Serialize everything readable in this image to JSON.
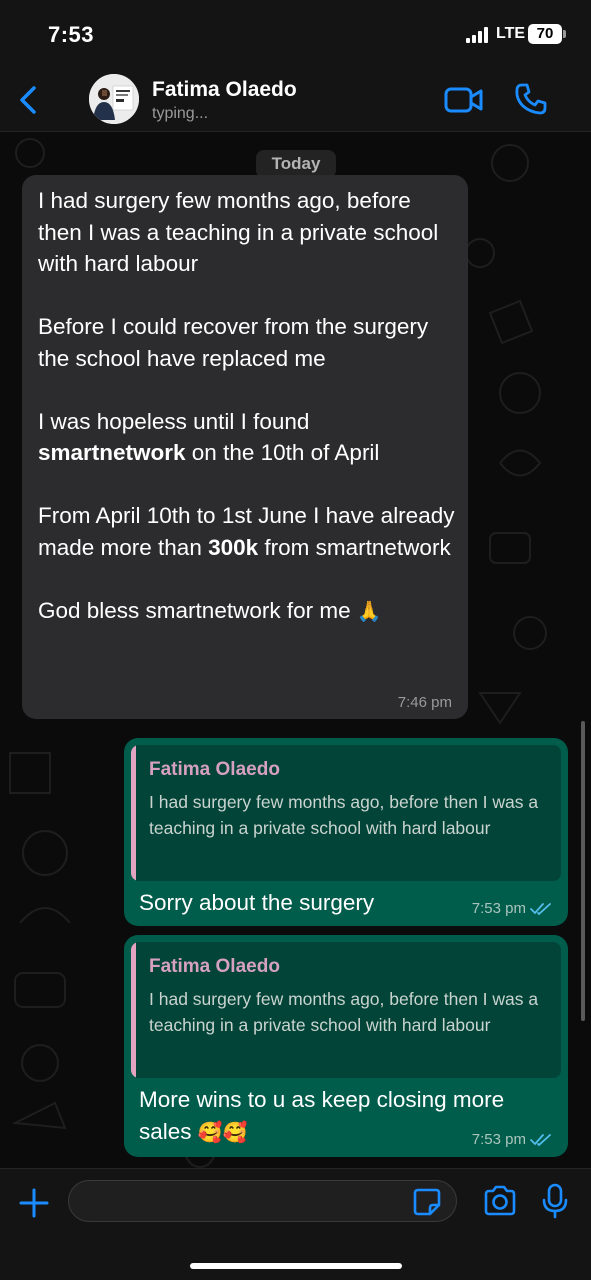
{
  "status_bar": {
    "time": "7:53",
    "network": "LTE",
    "battery": "70"
  },
  "header": {
    "contact_name": "Fatima Olaedo",
    "contact_status": "typing...",
    "icons": [
      "back-chevron-icon",
      "video-camera-icon",
      "phone-icon"
    ],
    "accent_color": "#1a8cff"
  },
  "chat": {
    "date_label": "Today",
    "incoming": {
      "p1": "I had surgery few months ago, before then I was a teaching in a private school with hard labour",
      "p2": "Before I could recover from the surgery the school have replaced me",
      "p3_before": "I was hopeless until I found ",
      "p3_bold": "smartnetwork",
      "p3_after": " on the 10th of April",
      "p4_before": "From April 10th to 1st June I have already made more than ",
      "p4_bold": "300k",
      "p4_after": " from smartnetwork",
      "p5": "God bless smartnetwork for me",
      "p5_emoji": "🙏",
      "time": "7:46 pm",
      "bubble_color": "#2c2c2e"
    },
    "outgoing": [
      {
        "quote_name": "Fatima Olaedo",
        "quote_text": "I had surgery few months ago, before then I was a teaching in a private school with hard labour",
        "text": "Sorry about the surgery",
        "emoji": "",
        "time": "7:53 pm"
      },
      {
        "quote_name": "Fatima Olaedo",
        "quote_text": "I had surgery few months ago, before then I was a teaching in a private school with hard labour",
        "text": "More wins to u as keep closing more sales ",
        "emoji": "🥰🥰",
        "time": "7:53 pm"
      }
    ],
    "outgoing_bubble_color": "#005c4b",
    "read_tick_color": "#53bdeb"
  },
  "input_bar": {
    "placeholder": "",
    "icons": [
      "plus-icon",
      "sticker-icon",
      "camera-icon",
      "microphone-icon"
    ]
  }
}
